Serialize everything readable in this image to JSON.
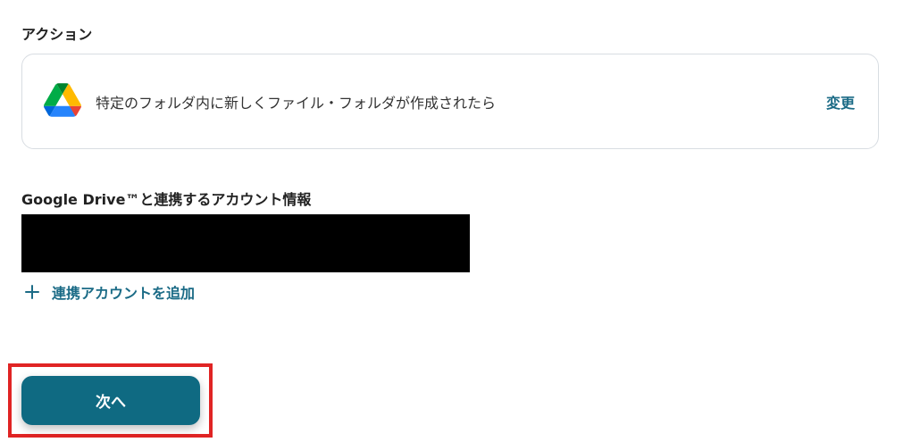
{
  "action_section": {
    "label": "アクション",
    "card": {
      "icon": "google-drive-icon",
      "description": "特定のフォルダ内に新しくファイル・フォルダが作成されたら",
      "change_label": "変更"
    }
  },
  "account_section": {
    "label": "Google Drive™と連携するアカウント情報",
    "add_account_label": "連携アカウントを追加"
  },
  "footer": {
    "next_label": "次へ"
  },
  "colors": {
    "accent": "#1b6b86",
    "button": "#0f6a82",
    "highlight": "#e02424",
    "card_border": "#d8dde2"
  }
}
